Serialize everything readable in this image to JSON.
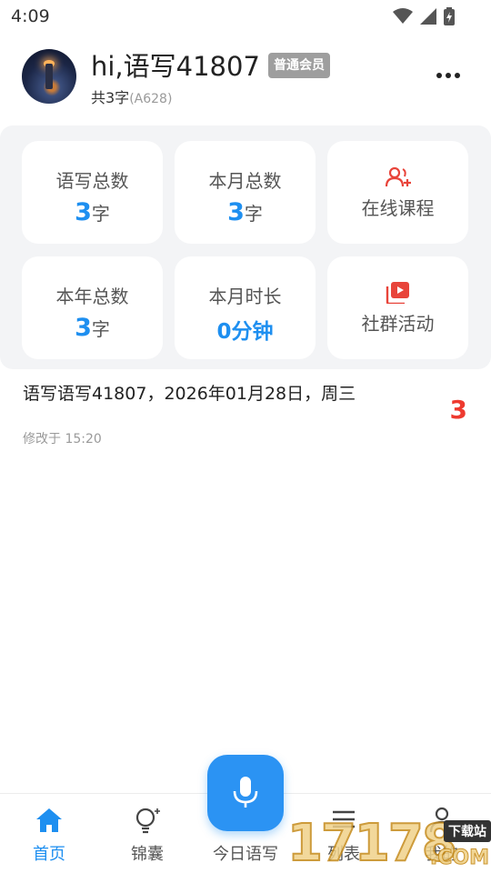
{
  "status_bar": {
    "time": "4:09",
    "icons": [
      "wifi-icon",
      "signal-icon",
      "battery-charging-icon"
    ]
  },
  "header": {
    "greeting": "hi,语写41807",
    "membership_badge": "普通会员",
    "total_prefix": "共3字",
    "account_code": "(A628)",
    "more_icon": "more-dots-icon"
  },
  "stats": {
    "total_words": {
      "label": "语写总数",
      "value": "3",
      "unit": "字"
    },
    "month_total": {
      "label": "本月总数",
      "value": "3",
      "unit": "字"
    },
    "online_courses": {
      "label": "在线课程",
      "icon": "user-add-icon",
      "color": "#e8443a"
    },
    "year_total": {
      "label": "本年总数",
      "value": "3",
      "unit": "字"
    },
    "month_duration": {
      "label": "本月时长",
      "value": "0分钟"
    },
    "community": {
      "label": "社群活动",
      "icon": "video-play-icon",
      "color": "#e8443a"
    }
  },
  "entry": {
    "title": "语写语写41807，2026年01月28日，周三",
    "count": "3",
    "modified": "修改于 15:20"
  },
  "bottom_nav": {
    "home": {
      "label": "首页",
      "icon": "home-icon",
      "active": true
    },
    "tips": {
      "label": "锦囊",
      "icon": "lightbulb-icon"
    },
    "today": {
      "label": "今日语写",
      "icon": "microphone-icon"
    },
    "list": {
      "label": "列表",
      "icon": "list-icon"
    },
    "mine": {
      "label": "我的",
      "icon": "person-icon"
    }
  },
  "watermark": {
    "digits": "17178",
    "suffix": ".COM",
    "tag": "下载站"
  },
  "colors": {
    "accent": "#1e8ff0",
    "red": "#ee3a2f",
    "panel_bg": "#f3f4f6"
  }
}
